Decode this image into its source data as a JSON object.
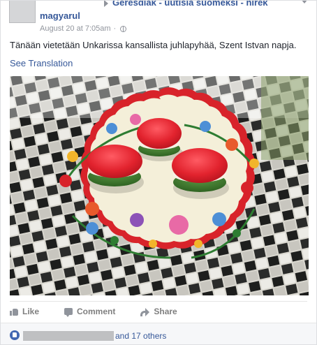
{
  "post": {
    "group_name_line1": "Geresdiak - uutisia suomeksi - hírek",
    "group_name_line2": "magyarul",
    "timestamp": "August 20 at 7:05am",
    "separator": "·",
    "body": "Tänään vietetään Unkarissa kansallista juhlapyhää, Szent Istvan napja.",
    "see_translation": "See Translation"
  },
  "actions": {
    "like": "Like",
    "comment": "Comment",
    "share": "Share"
  },
  "reactions": {
    "others_text": "and 17 others"
  },
  "colors": {
    "link_blue": "#365899",
    "meta_gray": "#90949c",
    "like_blue": "#4267b2",
    "macaron_red": "#e2232e",
    "macaron_green": "#3c7a2c",
    "doily_red": "#d8232a",
    "doily_cream": "#f4efd9"
  },
  "icons": [
    "avatar",
    "chevron-right-icon",
    "chevron-down-icon",
    "globe-icon",
    "like-icon",
    "comment-icon",
    "share-icon",
    "like-badge-icon"
  ]
}
